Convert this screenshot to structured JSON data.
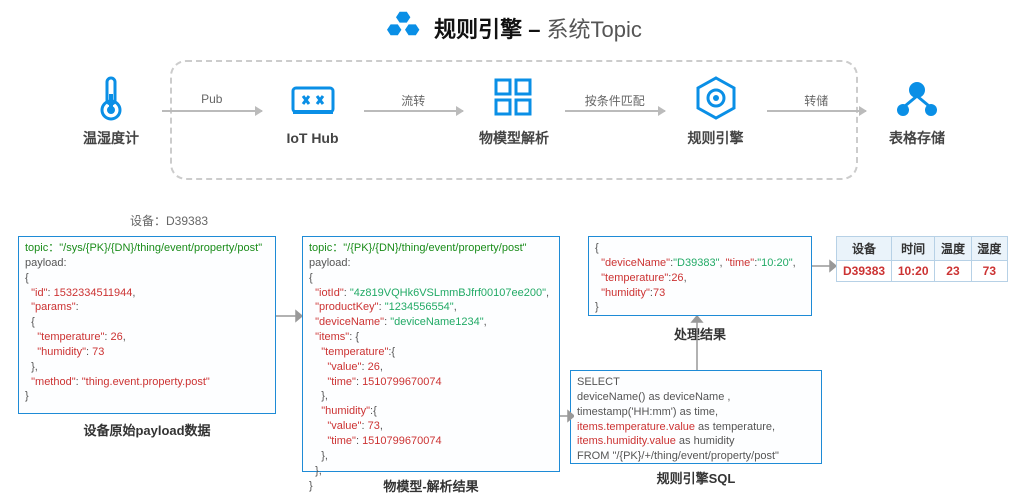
{
  "title": {
    "prefix": "规则引擎 – ",
    "suffix": "系统Topic"
  },
  "flow": {
    "nodes": [
      {
        "label": "温湿度计"
      },
      {
        "label": "IoT Hub"
      },
      {
        "label": "物模型解析"
      },
      {
        "label": "规则引擎"
      },
      {
        "label": "表格存储"
      }
    ],
    "arrows": [
      "Pub",
      "流转",
      "按条件匹配",
      "转储"
    ]
  },
  "deviceTag": "设备：D39383",
  "panel1": {
    "topicLabel": "topic：",
    "topic": "\"/sys/{PK}/{DN}/thing/event/property/post\"",
    "payloadLabel": "payload:",
    "id": "1532334511944",
    "temperature": "26",
    "humidity": "73",
    "method": "\"thing.event.property.post\"",
    "caption": "设备原始payload数据"
  },
  "panel2": {
    "topicLabel": "topic：",
    "topic": "\"/{PK}/{DN}/thing/event/property/post\"",
    "payloadLabel": "payload:",
    "iotId": "\"4z819VQHk6VSLmmBJfrf00107ee200\"",
    "productKey": "\"1234556554\"",
    "deviceName": "\"deviceName1234\"",
    "tempValue": "26",
    "tempTime": "1510799670074",
    "humValue": "73",
    "humTime": "1510799670074",
    "caption": "物模型-解析结果"
  },
  "panel3": {
    "deviceName": "\"D39383\"",
    "time": "\"10:20\"",
    "temperature": "26",
    "humidity": "73",
    "caption": "处理结果"
  },
  "panel4": {
    "line1a": "SELECT",
    "line2a": "deviceName() as deviceName ,",
    "line3a": "timestamp('HH:mm') as time,",
    "line4a": "items.temperature.value",
    "line4b": " as temperature,",
    "line5a": "items.humidity.value",
    "line5b": " as humidity",
    "line6a": "FROM \"/{PK}/+/thing/event/property/post\"",
    "caption": "规则引擎SQL"
  },
  "table": {
    "headers": [
      "设备",
      "时间",
      "温度",
      "湿度"
    ],
    "row": [
      "D39383",
      "10:20",
      "23",
      "73"
    ]
  }
}
